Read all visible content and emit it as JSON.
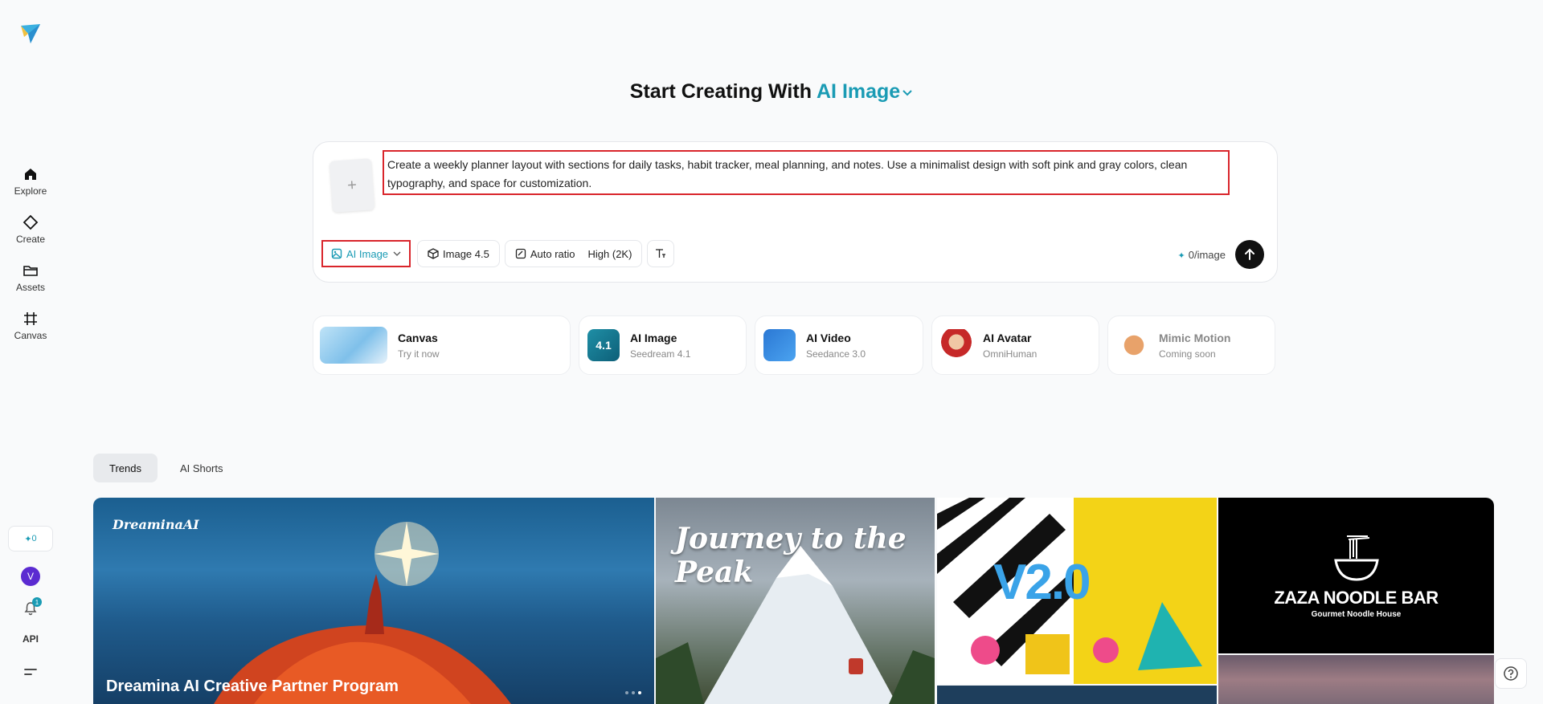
{
  "sidebar": {
    "items": [
      {
        "label": "Explore"
      },
      {
        "label": "Create"
      },
      {
        "label": "Assets"
      },
      {
        "label": "Canvas"
      }
    ],
    "credits": "0",
    "avatar_letter": "V",
    "notifications_count": "1",
    "api_label": "API"
  },
  "hero": {
    "prefix": "Start Creating With",
    "mode": "AI Image"
  },
  "prompt": {
    "text": "Create a weekly planner layout with sections for daily tasks, habit tracker, meal planning, and notes. Use a minimalist design with soft pink and gray colors, clean typography, and space for customization.",
    "upload_symbol": "+",
    "toolbar": {
      "mode": "AI Image",
      "model": "Image 4.5",
      "ratio": "Auto ratio",
      "quality": "High (2K)"
    },
    "cost": "0/image"
  },
  "features": [
    {
      "title": "Canvas",
      "subtitle": "Try it now"
    },
    {
      "title": "AI Image",
      "subtitle": "Seedream 4.1",
      "badge": "4.1"
    },
    {
      "title": "AI Video",
      "subtitle": "Seedance 3.0"
    },
    {
      "title": "AI Avatar",
      "subtitle": "OmniHuman"
    },
    {
      "title": "Mimic Motion",
      "subtitle": "Coming soon"
    }
  ],
  "tabs": [
    {
      "label": "Trends"
    },
    {
      "label": "AI Shorts"
    }
  ],
  "gallery": {
    "banner_brand": "DreaminaAI",
    "banner_title": "Dreamina AI Creative Partner Program",
    "journey_title": "Journey to the Peak",
    "v2_title": "V2.0",
    "noodle_title": "ZAZA NOODLE BAR",
    "noodle_subtitle": "Gourmet Noodle House"
  },
  "colors": {
    "accent": "#1a9bb4",
    "highlight_box": "#d9252b"
  }
}
